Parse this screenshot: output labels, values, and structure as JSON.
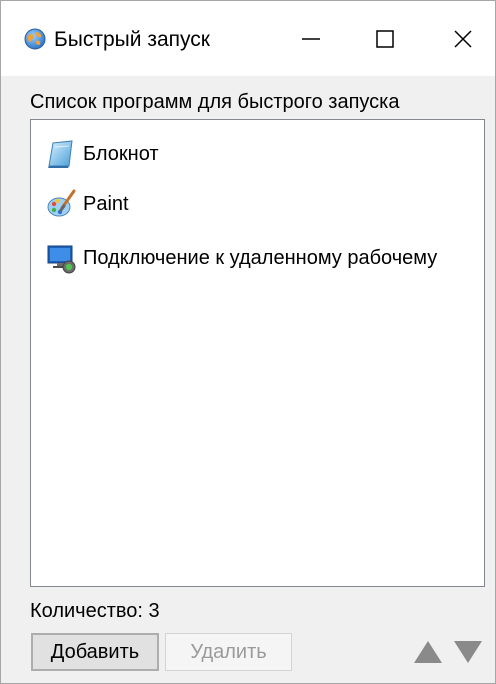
{
  "window": {
    "title": "Быстрый запуск"
  },
  "titlebar_controls": {
    "minimize_icon": "minimize-icon",
    "maximize_icon": "maximize-icon",
    "close_icon": "close-icon"
  },
  "list": {
    "label": "Список программ для быстрого запуска",
    "items": [
      {
        "label": "Блокнот",
        "icon": "notepad-icon"
      },
      {
        "label": "Paint",
        "icon": "paint-icon"
      },
      {
        "label": "Подключение к удаленному рабочему",
        "icon": "remote-desktop-icon"
      }
    ]
  },
  "footer": {
    "count_text": "Количество: 3",
    "add_label": "Добавить",
    "delete_label": "Удалить",
    "delete_enabled": false,
    "move_up_icon": "arrow-up-icon",
    "move_down_icon": "arrow-down-icon"
  },
  "colors": {
    "window_bg": "#f0f0f0",
    "titlebar_bg": "#ffffff",
    "list_bg": "#ffffff",
    "list_border": "#828790",
    "disabled_text": "#9a9a9a",
    "arrow_gray": "#8a8a8a"
  }
}
